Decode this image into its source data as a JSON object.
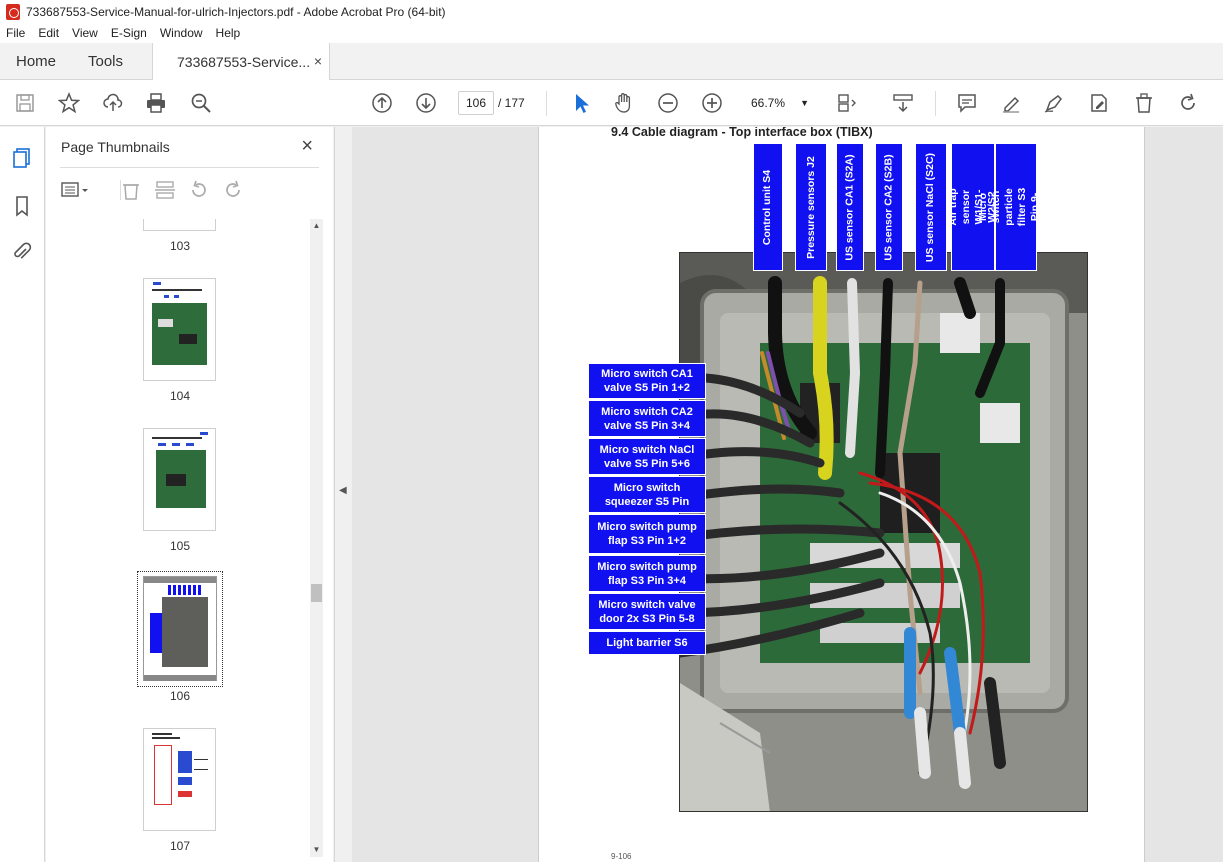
{
  "window": {
    "title": "733687553-Service-Manual-for-ulrich-Injectors.pdf - Adobe Acrobat Pro (64-bit)"
  },
  "menu": {
    "items": [
      "File",
      "Edit",
      "View",
      "E-Sign",
      "Window",
      "Help"
    ]
  },
  "tabs": {
    "home": "Home",
    "tools": "Tools",
    "doc": "733687553-Service...",
    "close": "×"
  },
  "toolbar": {
    "current_page": "106",
    "total_pages": "/  177",
    "zoom": "66.7%"
  },
  "thumbnails": {
    "title": "Page Thumbnails",
    "close": "×",
    "pages": [
      {
        "label": "103"
      },
      {
        "label": "104"
      },
      {
        "label": "105"
      },
      {
        "label": "106"
      },
      {
        "label": "107"
      }
    ]
  },
  "document": {
    "heading": "9.4   Cable diagram - Top interface box (TIBX)",
    "footer": "9-106",
    "top_labels": [
      "Control unit S4",
      "Pressure sensors J2",
      "US sensor CA1 (S2A)",
      "US sensor CA2 (S2B)",
      "US sensor NaCl (S2C)",
      "Air trap sensor W1/S1-W2/S2",
      "Micro switch particle filter S3 Pin 9-10"
    ],
    "side_labels": [
      "Micro switch CA1 valve S5 Pin 1+2",
      "Micro switch CA2 valve S5 Pin 3+4",
      "Micro switch NaCl valve S5 Pin 5+6",
      "Micro switch squeezer S5 Pin",
      "Micro switch pump flap S3 Pin 1+2",
      "Micro switch pump flap S3 Pin 3+4",
      "Micro switch valve door 2x S3 Pin 5-8",
      "Light barrier S6"
    ]
  },
  "colors": {
    "label_blue": "#1010f0",
    "acrobat_red": "#d52b1e"
  }
}
